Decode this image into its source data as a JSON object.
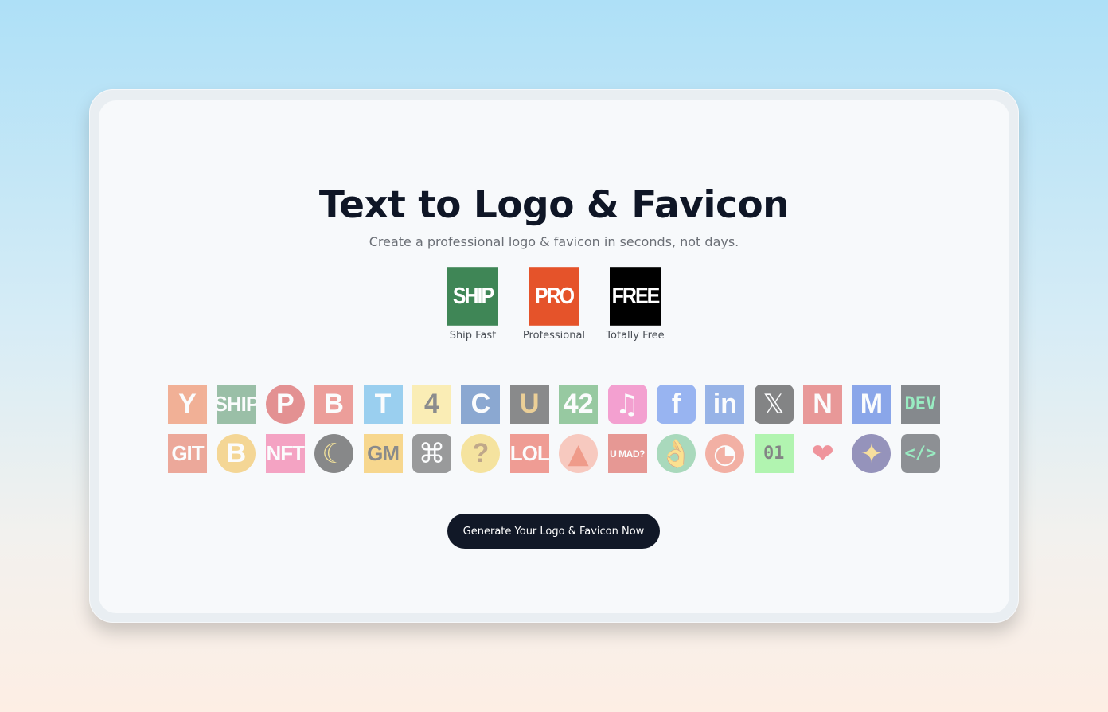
{
  "title": "Text to Logo & Favicon",
  "subtitle": "Create a professional logo & favicon in seconds, not days.",
  "features": [
    {
      "logo_text": "SHIP",
      "caption": "Ship Fast",
      "bg": "#3f8656",
      "name": "ship-fast"
    },
    {
      "logo_text": "PRO",
      "caption": "Professional",
      "bg": "#e5532a",
      "name": "professional"
    },
    {
      "logo_text": "FREE",
      "caption": "Totally Free",
      "bg": "#000000",
      "name": "totally-free"
    }
  ],
  "examples": [
    {
      "text": "Y",
      "bg": "#ec6a33",
      "fg": "#ffffff",
      "shape": "square",
      "size": "",
      "name": "y"
    },
    {
      "text": "SHIP",
      "bg": "#3f8656",
      "fg": "#ffffff",
      "shape": "square",
      "size": "sm",
      "name": "ship"
    },
    {
      "text": "P",
      "bg": "#d12c2c",
      "fg": "#ffffff",
      "shape": "circle",
      "size": "",
      "name": "p"
    },
    {
      "text": "B",
      "bg": "#e3463c",
      "fg": "#ffffff",
      "shape": "square",
      "size": "",
      "name": "b"
    },
    {
      "text": "T",
      "bg": "#3fa7e4",
      "fg": "#ffffff",
      "shape": "square",
      "size": "",
      "name": "t"
    },
    {
      "text": "4",
      "bg": "#fde371",
      "fg": "#222222",
      "shape": "square",
      "size": "",
      "name": "four"
    },
    {
      "text": "C",
      "bg": "#215aa8",
      "fg": "#ffffff",
      "shape": "square",
      "size": "",
      "name": "c"
    },
    {
      "text": "U",
      "bg": "#1e1e1e",
      "fg": "#e1a636",
      "shape": "square",
      "size": "",
      "name": "u"
    },
    {
      "text": "42",
      "bg": "#3a9a49",
      "fg": "#ffffff",
      "shape": "square",
      "size": "",
      "name": "forty-two"
    },
    {
      "text": "♫",
      "bg": "#f04aa6",
      "fg": "#ffffff",
      "shape": "round",
      "size": "emoji",
      "name": "music"
    },
    {
      "text": "f",
      "bg": "#3b72e8",
      "fg": "#ffffff",
      "shape": "round",
      "size": "",
      "name": "facebook"
    },
    {
      "text": "in",
      "bg": "#3a6fd4",
      "fg": "#ffffff",
      "shape": "square",
      "size": "",
      "name": "linkedin"
    },
    {
      "text": "𝕏",
      "bg": "#111111",
      "fg": "#ffffff",
      "shape": "round",
      "size": "emoji",
      "name": "x"
    },
    {
      "text": "N",
      "bg": "#da3a37",
      "fg": "#ffffff",
      "shape": "square",
      "size": "",
      "name": "n"
    },
    {
      "text": "M",
      "bg": "#1f55d8",
      "fg": "#ffffff",
      "shape": "square",
      "size": "",
      "name": "m"
    },
    {
      "text": "DEV",
      "bg": "#151b22",
      "fg": "#3de08a",
      "shape": "square",
      "size": "mono",
      "name": "dev"
    },
    {
      "text": "GIT",
      "bg": "#e35a3c",
      "fg": "#ffffff",
      "shape": "square",
      "size": "sm",
      "name": "git"
    },
    {
      "text": "B",
      "bg": "#f2b531",
      "fg": "#ffffff",
      "shape": "circle",
      "size": "",
      "name": "bitcoin"
    },
    {
      "text": "NFT",
      "bg": "#f24f8d",
      "fg": "#ffffff",
      "shape": "square",
      "size": "sm",
      "name": "nft"
    },
    {
      "text": "☾",
      "bg": "#1a1a1a",
      "fg": "#f2cf3c",
      "shape": "circle",
      "size": "emoji",
      "name": "moon"
    },
    {
      "text": "GM",
      "bg": "#f7b624",
      "fg": "#1e1e1e",
      "shape": "square",
      "size": "sm",
      "name": "gm"
    },
    {
      "text": "⌘",
      "bg": "#3d3d3d",
      "fg": "#ffffff",
      "shape": "round",
      "size": "emoji",
      "name": "command"
    },
    {
      "text": "?",
      "bg": "#f5cf45",
      "fg": "#8a5a1c",
      "shape": "circle",
      "size": "",
      "name": "thinking"
    },
    {
      "text": "LOL",
      "bg": "#e9412f",
      "fg": "#ffffff",
      "shape": "square",
      "size": "sm",
      "name": "lol"
    },
    {
      "text": "▲",
      "bg": "#f79a84",
      "fg": "#e8401c",
      "shape": "circle",
      "size": "emoji",
      "name": "fire"
    },
    {
      "text": "U MAD?",
      "bg": "#d7392f",
      "fg": "#ffffff",
      "shape": "square",
      "size": "xs",
      "name": "u-mad"
    },
    {
      "text": "👌",
      "bg": "#5dbb7e",
      "fg": "#f5c64b",
      "shape": "circle",
      "size": "emoji",
      "name": "ok"
    },
    {
      "text": "◔",
      "bg": "#ef6a4f",
      "fg": "#ffffff",
      "shape": "circle",
      "size": "emoji",
      "name": "pizza"
    },
    {
      "text": "01",
      "bg": "#6ef068",
      "fg": "#111111",
      "shape": "square",
      "size": "mono",
      "name": "binary"
    },
    {
      "text": "❤",
      "bg": "transparent",
      "fg": "#e8323f",
      "shape": "square",
      "size": "emoji",
      "name": "heart"
    },
    {
      "text": "✦",
      "bg": "#352f7c",
      "fg": "#f7c744",
      "shape": "circle",
      "size": "emoji",
      "name": "sparkle"
    },
    {
      "text": "</>",
      "bg": "#252a30",
      "fg": "#3de08a",
      "shape": "round",
      "size": "mono",
      "name": "code"
    }
  ],
  "cta_label": "Generate Your Logo & Favicon Now"
}
